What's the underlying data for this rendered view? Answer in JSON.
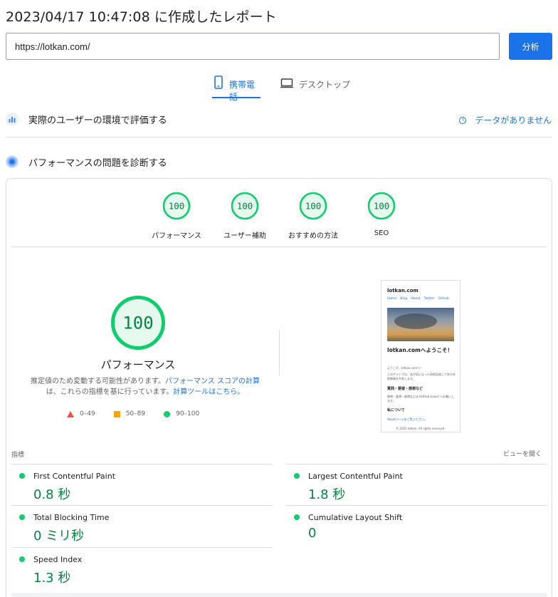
{
  "header": {
    "report_title": "2023/04/17 10:47:08 に作成したレポート"
  },
  "url_bar": {
    "value": "https://lotkan.com/",
    "analyze_label": "分析"
  },
  "device_tabs": {
    "mobile_label": "携帯電話",
    "desktop_label": "デスクトップ",
    "selected": "mobile"
  },
  "field_data": {
    "title": "実際のユーザーの環境で評価する",
    "no_data_label": "データがありません"
  },
  "lab_data": {
    "title": "パフォーマンスの問題を診断する"
  },
  "categories": [
    {
      "score": "100",
      "label": "パフォーマンス"
    },
    {
      "score": "100",
      "label": "ユーザー補助"
    },
    {
      "score": "100",
      "label": "おすすめの方法"
    },
    {
      "score": "100",
      "label": "SEO"
    }
  ],
  "performance": {
    "score": "100",
    "label": "パフォーマンス",
    "desc_line1_prefix": "推定値のため変動する可能性があります。",
    "desc_line1_link": "パフォーマンス スコアの計算",
    "desc_line2_prefix": "は、これらの指標を基に行っています。",
    "desc_line2_link": "計算ツールはこちら。"
  },
  "legend": [
    {
      "range": "0–49",
      "color": "#ff4e42",
      "shape": "triangle"
    },
    {
      "range": "50–89",
      "color": "#ffa400",
      "shape": "square"
    },
    {
      "range": "90–100",
      "color": "#0cce6b",
      "shape": "circle"
    }
  ],
  "screenshot_preview": {
    "site_name": "lotkan.com",
    "nav": [
      "Home",
      "Blog",
      "About",
      "Twitter",
      "Github"
    ],
    "welcome": "lotkan.comへようこそ！",
    "intro": "ようこそ、lotkan.comへ！",
    "body": "このサイトでは、私が気になった技術記録して残す技術情報を共有します。",
    "contact_heading": "質問・要望・感想など",
    "contact_body": "質問・要望・感想などは GitHub Issues へお願いします。",
    "about_heading": "私について",
    "about_link": "Aboutページをご覧ください。",
    "footer": "© 2022 lotkan. All rights reserved."
  },
  "metrics": {
    "section_label": "指標",
    "expand_label": "ビューを開く",
    "items": [
      {
        "name": "First Contentful Paint",
        "value": "0.8 秒",
        "status_color": "#0cce6b"
      },
      {
        "name": "Largest Contentful Paint",
        "value": "1.8 秒",
        "status_color": "#0cce6b"
      },
      {
        "name": "Total Blocking Time",
        "value": "0 ミリ秒",
        "status_color": "#0cce6b"
      },
      {
        "name": "Cumulative Layout Shift",
        "value": "0",
        "status_color": "#0cce6b"
      },
      {
        "name": "Speed Index",
        "value": "1.3 秒",
        "status_color": "#0cce6b"
      }
    ]
  },
  "colors": {
    "accent": "#1a73e8",
    "pass": "#0cce6b",
    "pass_text": "#018642",
    "pass_fill": "#e6f9ee"
  }
}
